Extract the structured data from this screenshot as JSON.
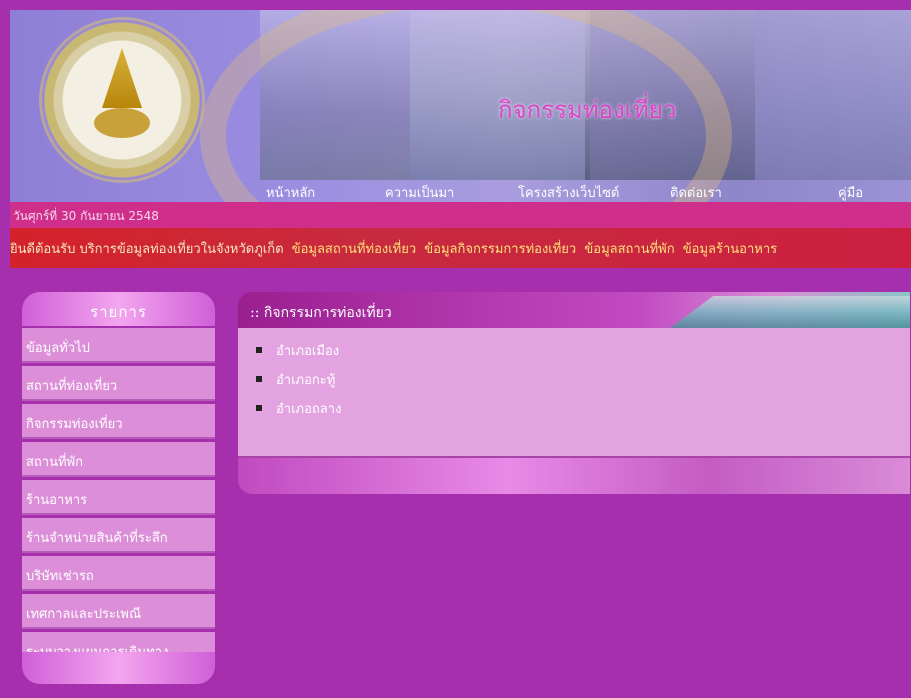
{
  "banner": {
    "title": "กิจกรรมท่องเที่ยว",
    "nav": [
      "หน้าหลัก",
      "ความเป็นมา",
      "โครงสร้างเว็บไซต์",
      "ติดต่อเรา",
      "คู่มือ"
    ]
  },
  "date_text": "วันศุกร์ที่ 30 กันยายน 2548",
  "ticker": {
    "welcome": "ยินดีต้อนรับ บริการข้อมูลท่องเที่ยวในจังหวัดภูเก็ต",
    "links": [
      "ข้อมูลสถานที่ท่องเที่ยว",
      "ข้อมูลกิจกรรมการท่องเที่ยว",
      "ข้อมูลสถานที่พัก",
      "ข้อมูลร้านอาหาร"
    ]
  },
  "sidebar": {
    "heading": "รายการ",
    "items": [
      "ข้อมูลทั่วไป",
      "สถานที่ท่องเที่ยว",
      "กิจกรรมท่องเที่ยว",
      "สถานที่พัก",
      "ร้านอาหาร",
      "ร้านจำหน่ายสินค้าที่ระลึก",
      "บริษัทเช่ารถ",
      "เทศกาลและประเพณี",
      "ระบบวางแผนการเดินทาง"
    ]
  },
  "content": {
    "heading": ":: กิจกรรมการท่องเที่ยว",
    "districts": [
      "อำเภอเมือง",
      "อำเภอกะทู้",
      "อำเภอถลาง"
    ]
  },
  "colors": {
    "background": "#a62fae",
    "date_bar": "#cf2f8a",
    "ticker_bar": "#d5222a",
    "menu_item": "#dc8fd8"
  }
}
